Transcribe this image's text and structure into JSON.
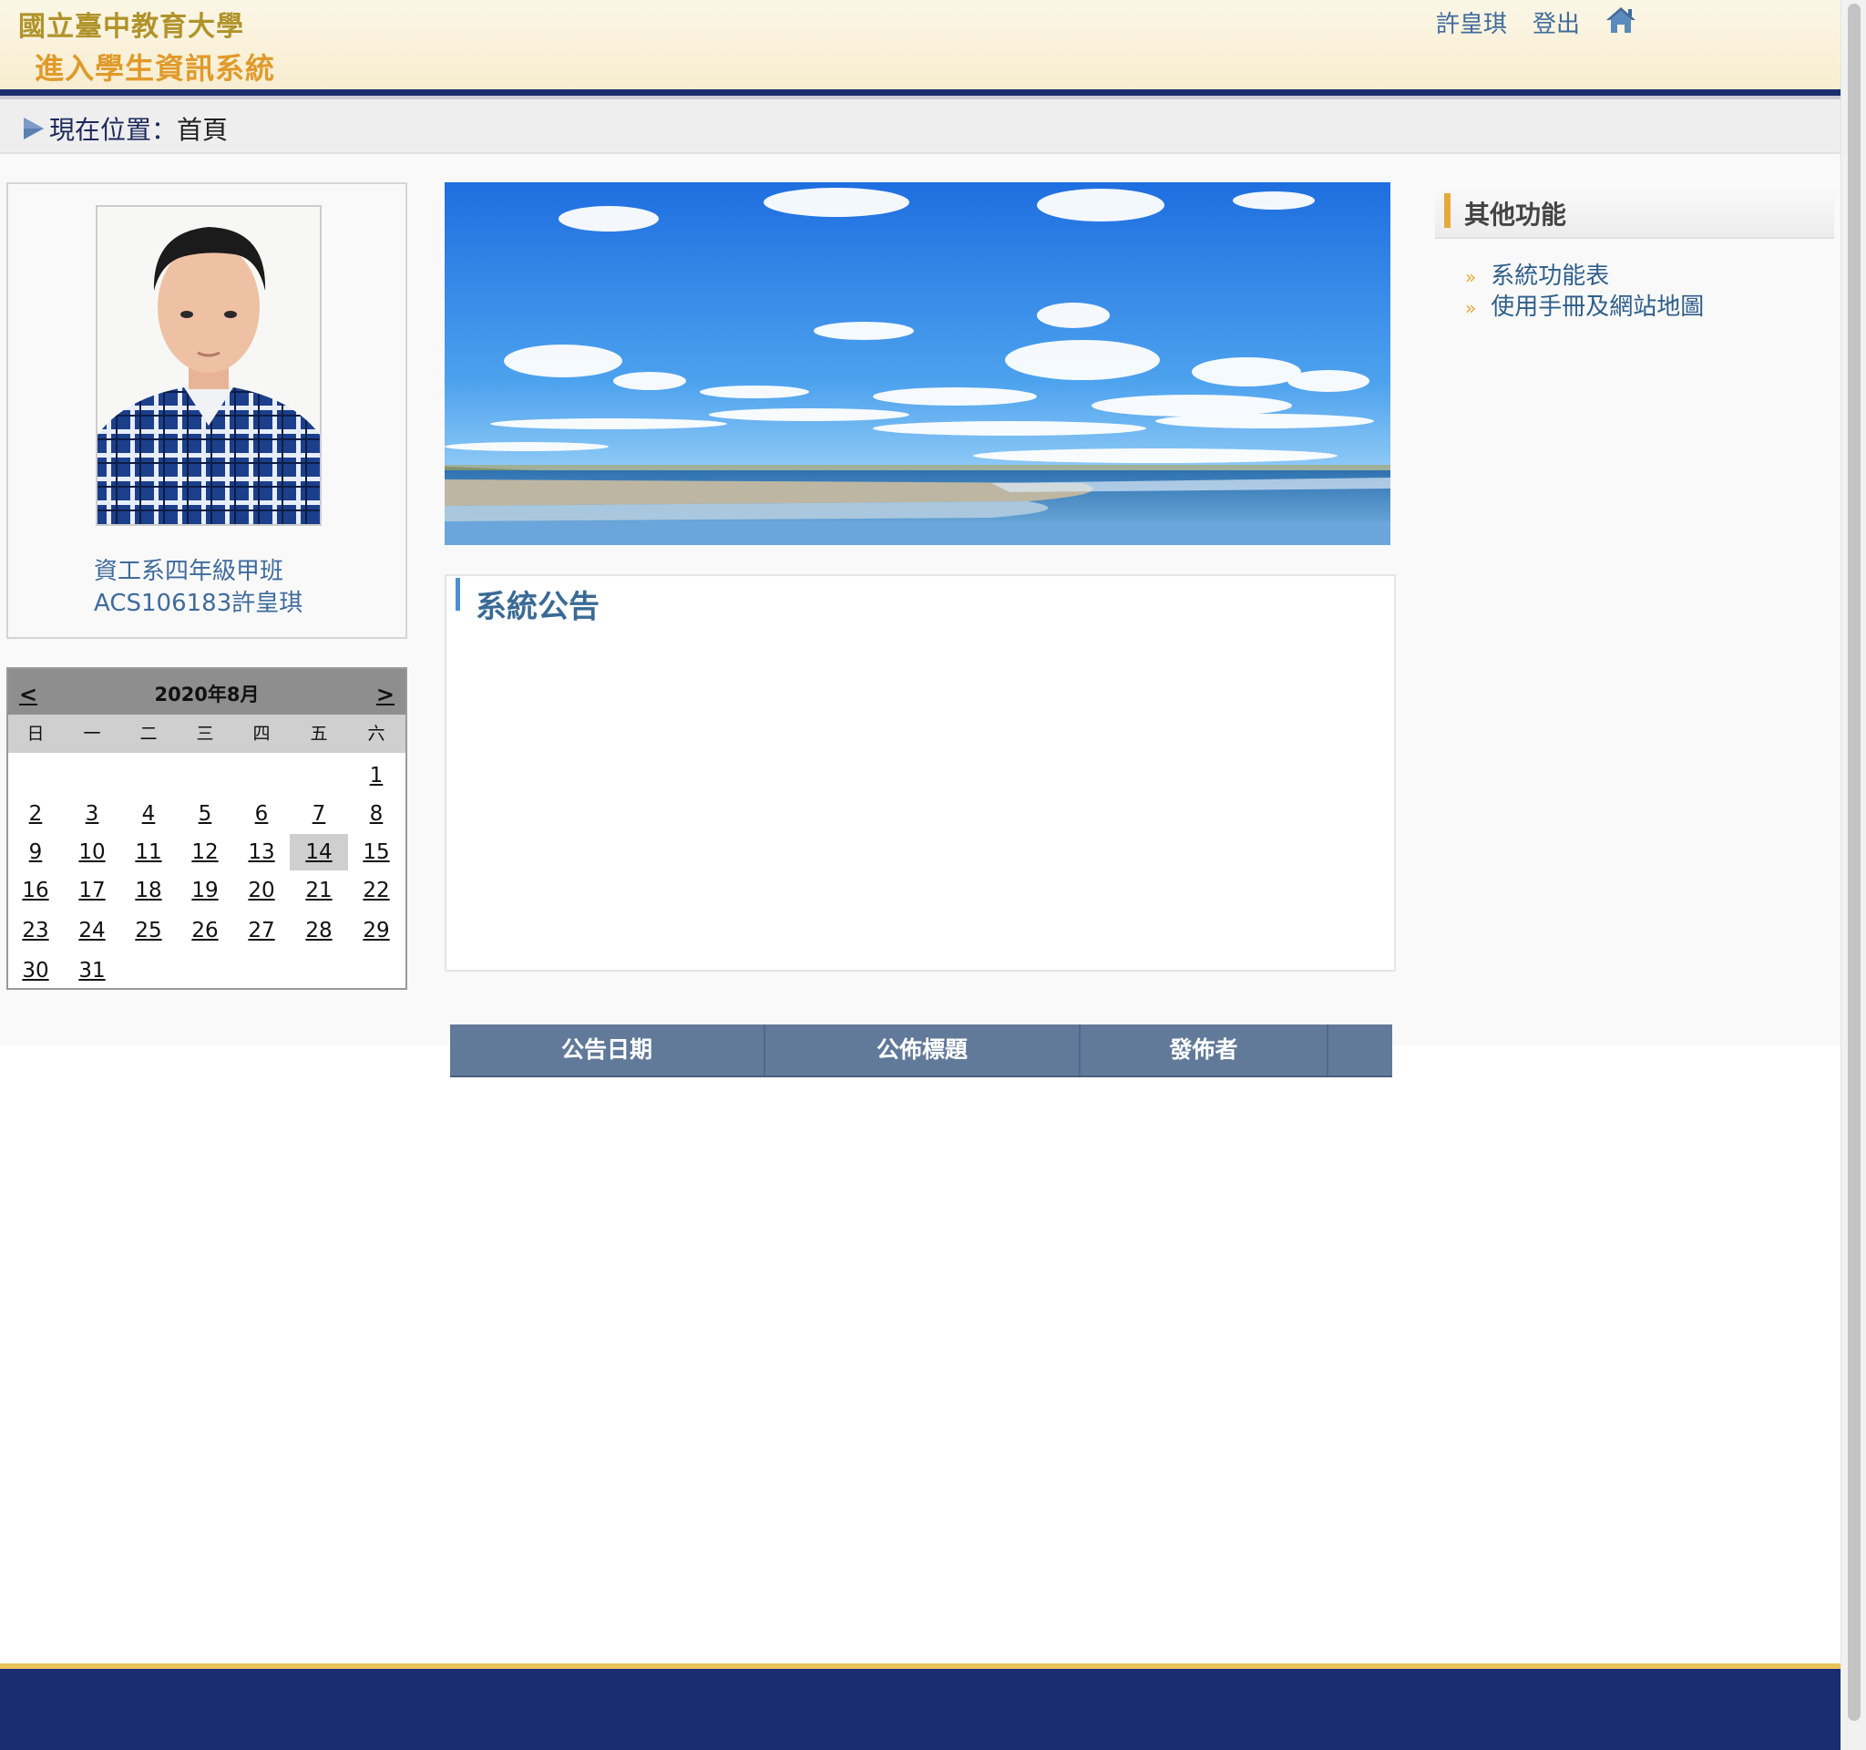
{
  "header": {
    "university": "國立臺中教育大學",
    "system": "進入學生資訊系統",
    "user": "許皇琪",
    "logout": "登出",
    "home_icon": "home-icon"
  },
  "breadcrumb": {
    "label": "現在位置：",
    "current": "首頁"
  },
  "profile": {
    "department": "資工系四年級甲班",
    "student_id_name": "ACS106183許皇琪"
  },
  "calendar": {
    "prev": "<",
    "next": ">",
    "title": "2020年8月",
    "weekdays": [
      "日",
      "一",
      "二",
      "三",
      "四",
      "五",
      "六"
    ],
    "days": [
      "1",
      "2",
      "3",
      "4",
      "5",
      "6",
      "7",
      "8",
      "9",
      "10",
      "11",
      "12",
      "13",
      "14",
      "15",
      "16",
      "17",
      "18",
      "19",
      "20",
      "21",
      "22",
      "23",
      "24",
      "25",
      "26",
      "27",
      "28",
      "29",
      "30",
      "31"
    ],
    "today": "14"
  },
  "announcement": {
    "title": "系統公告",
    "columns": [
      "公告日期",
      "公佈標題",
      "發佈者"
    ]
  },
  "sidebar": {
    "title": "其他功能",
    "items": [
      "系統功能表",
      "使用手冊及網站地圖"
    ]
  },
  "colors": {
    "header_band": "#1a2d6e",
    "footer": "#1a2d73",
    "accent_gold": "#e7a93a",
    "link": "#3f6b9b",
    "table_header": "#627a99"
  }
}
